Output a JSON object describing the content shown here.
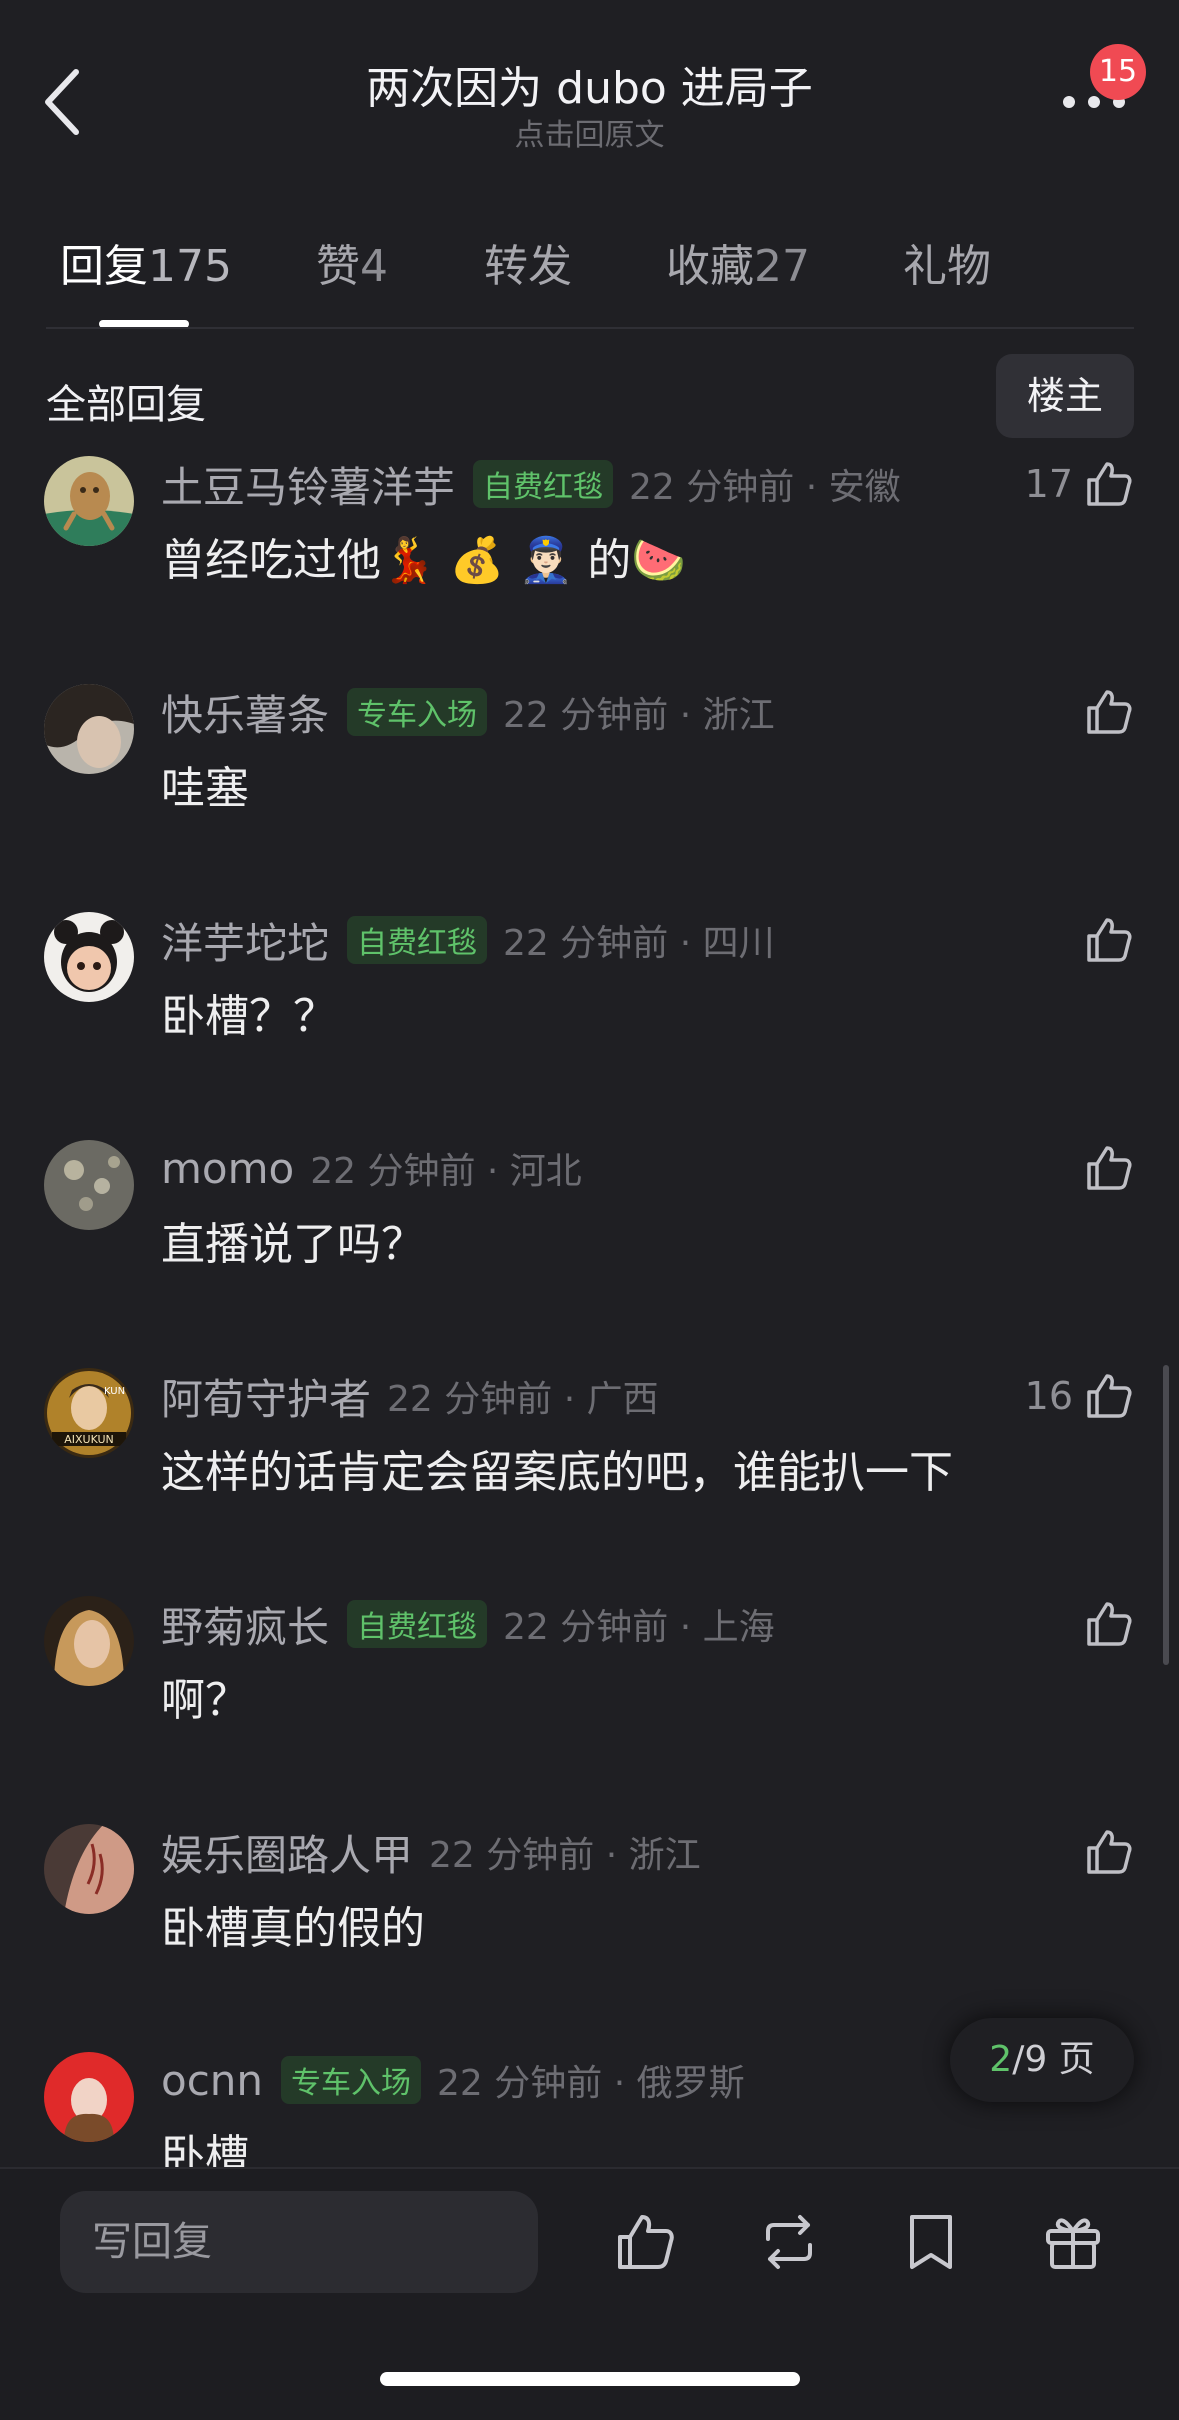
{
  "header": {
    "title": "两次因为 dubo 进局子",
    "subtitle": "点击回原文",
    "badge_count": "15"
  },
  "tabs": [
    {
      "label": "回复",
      "count": "175"
    },
    {
      "label": "赞",
      "count": "4"
    },
    {
      "label": "转发",
      "count": ""
    },
    {
      "label": "收藏",
      "count": "27"
    },
    {
      "label": "礼物",
      "count": ""
    }
  ],
  "section": {
    "title": "全部回复",
    "owner_button": "楼主"
  },
  "comments": [
    {
      "user": "土豆马铃薯洋芋",
      "tag": "自费红毯",
      "time": "22 分钟前 · 安徽",
      "text": "曾经吃过他💃 💰 👮🏻‍♂️ 的🍉",
      "likes": "17"
    },
    {
      "user": "快乐薯条",
      "tag": "专车入场",
      "time": "22 分钟前 · 浙江",
      "text": "哇塞",
      "likes": ""
    },
    {
      "user": "洋芋坨坨",
      "tag": "自费红毯",
      "time": "22 分钟前 · 四川",
      "text": "卧槽？？",
      "likes": ""
    },
    {
      "user": "momo",
      "tag": "",
      "time": "22 分钟前 · 河北",
      "text": "直播说了吗？",
      "likes": ""
    },
    {
      "user": "阿荀守护者",
      "tag": "",
      "time": "22 分钟前 · 广西",
      "text": "这样的话肯定会留案底的吧，谁能扒一下",
      "likes": "16"
    },
    {
      "user": "野菊疯长",
      "tag": "自费红毯",
      "time": "22 分钟前 · 上海",
      "text": "啊？",
      "likes": ""
    },
    {
      "user": "娱乐圈路人甲",
      "tag": "",
      "time": "22 分钟前 · 浙江",
      "text": "卧槽真的假的",
      "likes": ""
    },
    {
      "user": "ocnn",
      "tag": "专车入场",
      "time": "22 分钟前 · 俄罗斯",
      "text": "卧槽",
      "likes": ""
    }
  ],
  "avatar_labels": {
    "ai_xukun_line1": "KUN",
    "ai_xukun_line2": "AIXUKUN"
  },
  "pager": {
    "current": "2",
    "rest": "/9 页"
  },
  "bottom": {
    "reply_placeholder": "写回复"
  },
  "colors": {
    "background": "#1f1f23",
    "accent_green": "#5fc26a",
    "badge_red": "#f04a53"
  },
  "icons": [
    "back-icon",
    "more-icon",
    "thumbs-up-icon",
    "repost-icon",
    "bookmark-icon",
    "gift-icon"
  ]
}
